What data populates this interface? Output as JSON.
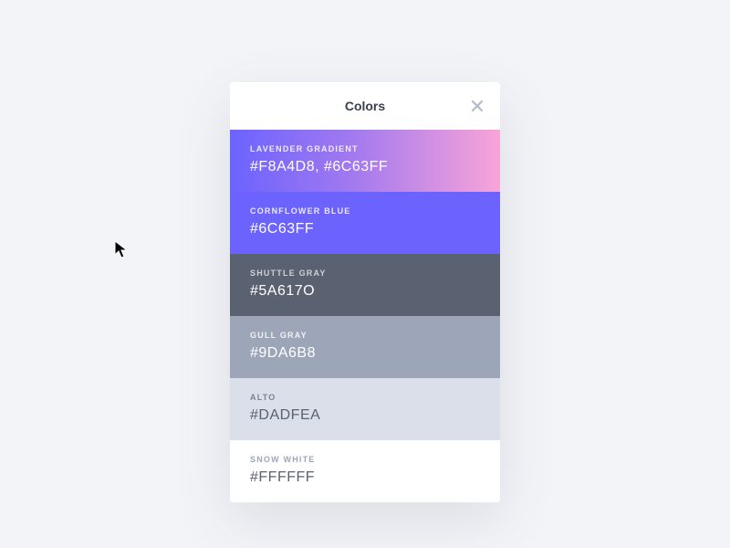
{
  "header": {
    "title": "Colors"
  },
  "swatches": [
    {
      "name": "LAVENDER GRADIENT",
      "value": "#F8A4D8, #6C63FF"
    },
    {
      "name": "CORNFLOWER BLUE",
      "value": "#6C63FF"
    },
    {
      "name": "SHUTTLE GRAY",
      "value": "#5A617O"
    },
    {
      "name": "GULL GRAY",
      "value": "#9DA6B8"
    },
    {
      "name": "ALTO",
      "value": "#DADFEA"
    },
    {
      "name": "SNOW WHITE",
      "value": "#FFFFFF"
    }
  ]
}
